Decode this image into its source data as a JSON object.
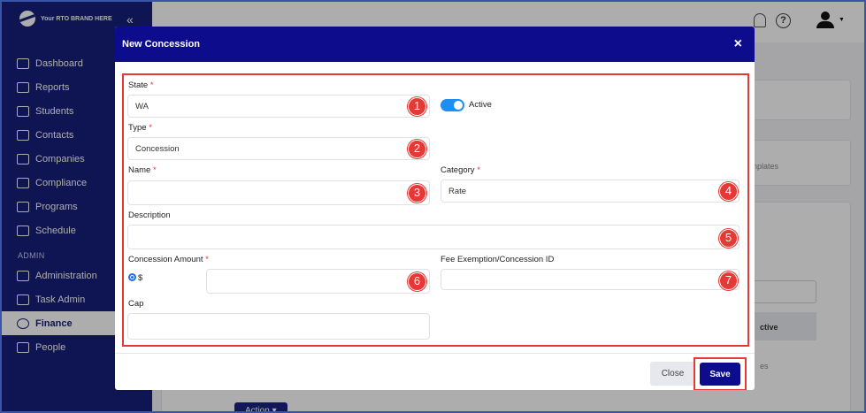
{
  "brand": {
    "name": "Your RTO BRAND HERE",
    "collapse_icon": "«"
  },
  "sidebar": {
    "items": [
      {
        "label": "Dashboard",
        "icon": "chart-icon"
      },
      {
        "label": "Reports",
        "icon": "report-icon"
      },
      {
        "label": "Students",
        "icon": "students-icon"
      },
      {
        "label": "Contacts",
        "icon": "contacts-icon"
      },
      {
        "label": "Companies",
        "icon": "companies-icon"
      },
      {
        "label": "Compliance",
        "icon": "compliance-icon"
      },
      {
        "label": "Programs",
        "icon": "programs-icon"
      },
      {
        "label": "Schedule",
        "icon": "schedule-icon"
      }
    ],
    "section_admin": "ADMIN",
    "admin_items": [
      {
        "label": "Administration",
        "icon": "administration-icon"
      },
      {
        "label": "Task Admin",
        "icon": "task-icon"
      },
      {
        "label": "Finance",
        "icon": "finance-icon",
        "active": true
      },
      {
        "label": "People",
        "icon": "people-icon"
      }
    ]
  },
  "topbar": {
    "help_glyph": "?",
    "caret": "▼"
  },
  "background": {
    "tab_fragment": "nplates",
    "col_fragment": "ctive",
    "cell_fragment": "es",
    "action_label": "Action ▾"
  },
  "modal": {
    "title": "New Concession",
    "close_glyph": "×",
    "fields": {
      "state": {
        "label": "State",
        "required": "*",
        "value": "WA",
        "badge": "1"
      },
      "active": {
        "label": "Active",
        "on": true
      },
      "type": {
        "label": "Type",
        "required": "*",
        "value": "Concession",
        "badge": "2"
      },
      "name": {
        "label": "Name",
        "required": "*",
        "value": "",
        "badge": "3"
      },
      "category": {
        "label": "Category",
        "required": "*",
        "value": "Rate",
        "badge": "4"
      },
      "description": {
        "label": "Description",
        "value": "",
        "badge": "5"
      },
      "concession_amount": {
        "label": "Concession Amount",
        "required": "*",
        "currency": "$",
        "value": "",
        "badge": "6"
      },
      "fee_exemption": {
        "label": "Fee Exemption/Concession ID",
        "value": "",
        "badge": "7"
      },
      "cap": {
        "label": "Cap",
        "value": ""
      }
    },
    "buttons": {
      "close": "Close",
      "save": "Save"
    }
  },
  "colors": {
    "sidebar": "#17207a",
    "header": "#0c0c8c",
    "highlight": "#e53935",
    "toggle": "#1e8ef0"
  }
}
